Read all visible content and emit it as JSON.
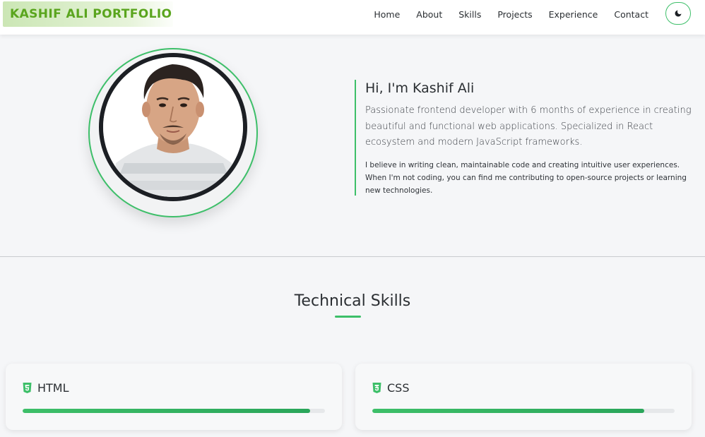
{
  "navbar": {
    "logo": "KASHIF ALI PORTFOLIO",
    "links": [
      "Home",
      "About",
      "Skills",
      "Projects",
      "Experience",
      "Contact"
    ],
    "theme_toggle_icon": "moon-icon"
  },
  "hero": {
    "title": "Hi, I'm Kashif Ali",
    "lead": "Passionate frontend developer with 6 months of experience in creating beautiful and functional web applications. Specialized in React ecosystem and modern JavaScript frameworks.",
    "body": "I believe in writing clean, maintainable code and creating intuitive user experiences. When I'm not coding, you can find me contributing to open-source projects or learning new technologies."
  },
  "skills": {
    "title": "Technical Skills",
    "items": [
      {
        "name": "HTML",
        "icon": "html5-icon",
        "level": 0.95
      },
      {
        "name": "CSS",
        "icon": "css3-icon",
        "level": 0.9
      }
    ]
  },
  "colors": {
    "accent": "#3dbf69",
    "logo_text": "#5aa51e",
    "background": "#f5f6f8"
  }
}
